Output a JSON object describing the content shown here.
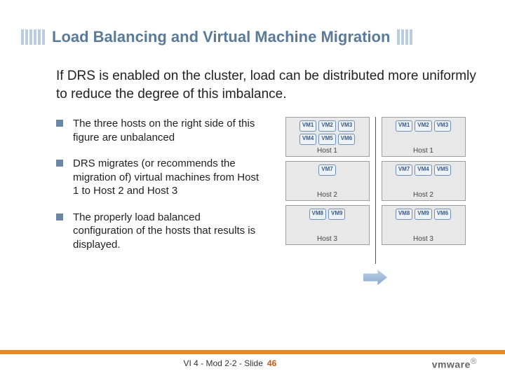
{
  "title": "Load Balancing and Virtual Machine Migration",
  "intro": "If DRS is enabled on the cluster, load can be distributed more uniformly to reduce the degree of this imbalance.",
  "bullets": [
    "The three hosts on the right side of this figure are unbalanced",
    "DRS migrates (or recommends the migration of) virtual machines from Host 1 to Host 2 and Host 3",
    "The properly load balanced configuration of the hosts that results is displayed."
  ],
  "diagram": {
    "left": [
      {
        "label": "Host 1",
        "rows": [
          [
            "VM1",
            "VM2",
            "VM3"
          ],
          [
            "VM4",
            "VM5",
            "VM6"
          ]
        ]
      },
      {
        "label": "Host 2",
        "rows": [
          [
            "VM7"
          ]
        ]
      },
      {
        "label": "Host 3",
        "rows": [
          [
            "VM8",
            "VM9"
          ]
        ]
      }
    ],
    "right": [
      {
        "label": "Host 1",
        "rows": [
          [
            "VM1",
            "VM2",
            "VM3"
          ]
        ]
      },
      {
        "label": "Host 2",
        "rows": [
          [
            "VM7",
            "VM4",
            "VM5"
          ]
        ]
      },
      {
        "label": "Host 3",
        "rows": [
          [
            "VM8",
            "VM9",
            "VM6"
          ]
        ]
      }
    ]
  },
  "footer": {
    "meta": "VI 4 - Mod 2-2 - Slide",
    "page": "46",
    "logo": "vmware"
  }
}
